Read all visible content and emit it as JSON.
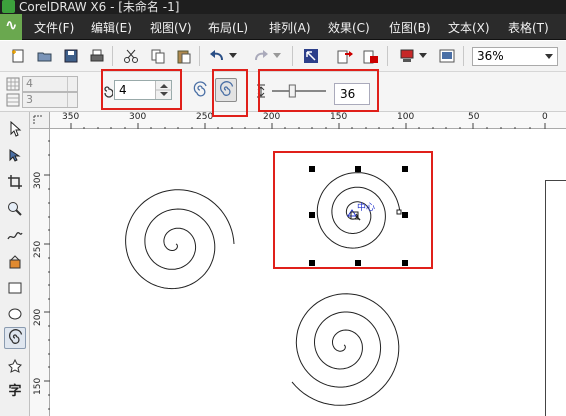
{
  "app": {
    "title": "CorelDRAW X6 - [未命名 -1]"
  },
  "menu": {
    "items": [
      "文件(F)",
      "编辑(E)",
      "视图(V)",
      "布局(L)",
      "排列(A)",
      "效果(C)",
      "位图(B)",
      "文本(X)",
      "表格(T)"
    ]
  },
  "toolbar": {
    "zoom_value": "36%",
    "icons": [
      "new-icon",
      "open-icon",
      "save-icon",
      "print-icon",
      "cut-icon",
      "copy-icon",
      "paste-icon",
      "undo-icon",
      "redo-icon",
      "import-icon",
      "export-icon",
      "publish-icon",
      "app-launcher-icon",
      "welcome-icon"
    ]
  },
  "property_bar": {
    "grid_rows": "4",
    "grid_cols": "3",
    "spiral_revolutions": "4",
    "spiral_expansion": "36",
    "spiral_modes": [
      "symmetrical-spiral",
      "logarithmic-spiral"
    ],
    "selected_mode": "logarithmic-spiral",
    "expansion_level": 0.36
  },
  "rulers": {
    "horizontal": [
      "350",
      "300",
      "250",
      "200",
      "150",
      "100",
      "50",
      "0"
    ],
    "vertical": [
      "300",
      "250",
      "200",
      "150"
    ]
  },
  "canvas": {
    "center_marker": "中心"
  },
  "toolbox": {
    "tools": [
      "pick-tool",
      "shape-tool",
      "crop-tool",
      "zoom-tool",
      "freehand-tool",
      "smart-fill-tool",
      "rectangle-tool",
      "ellipse-tool",
      "spiral-tool",
      "basic-shapes-tool",
      "text-tool"
    ],
    "text_tool_label": "字"
  },
  "colors": {
    "highlight": "#e0201a",
    "titlebar": "#1e1e1e",
    "menubar": "#2b2b2b"
  }
}
